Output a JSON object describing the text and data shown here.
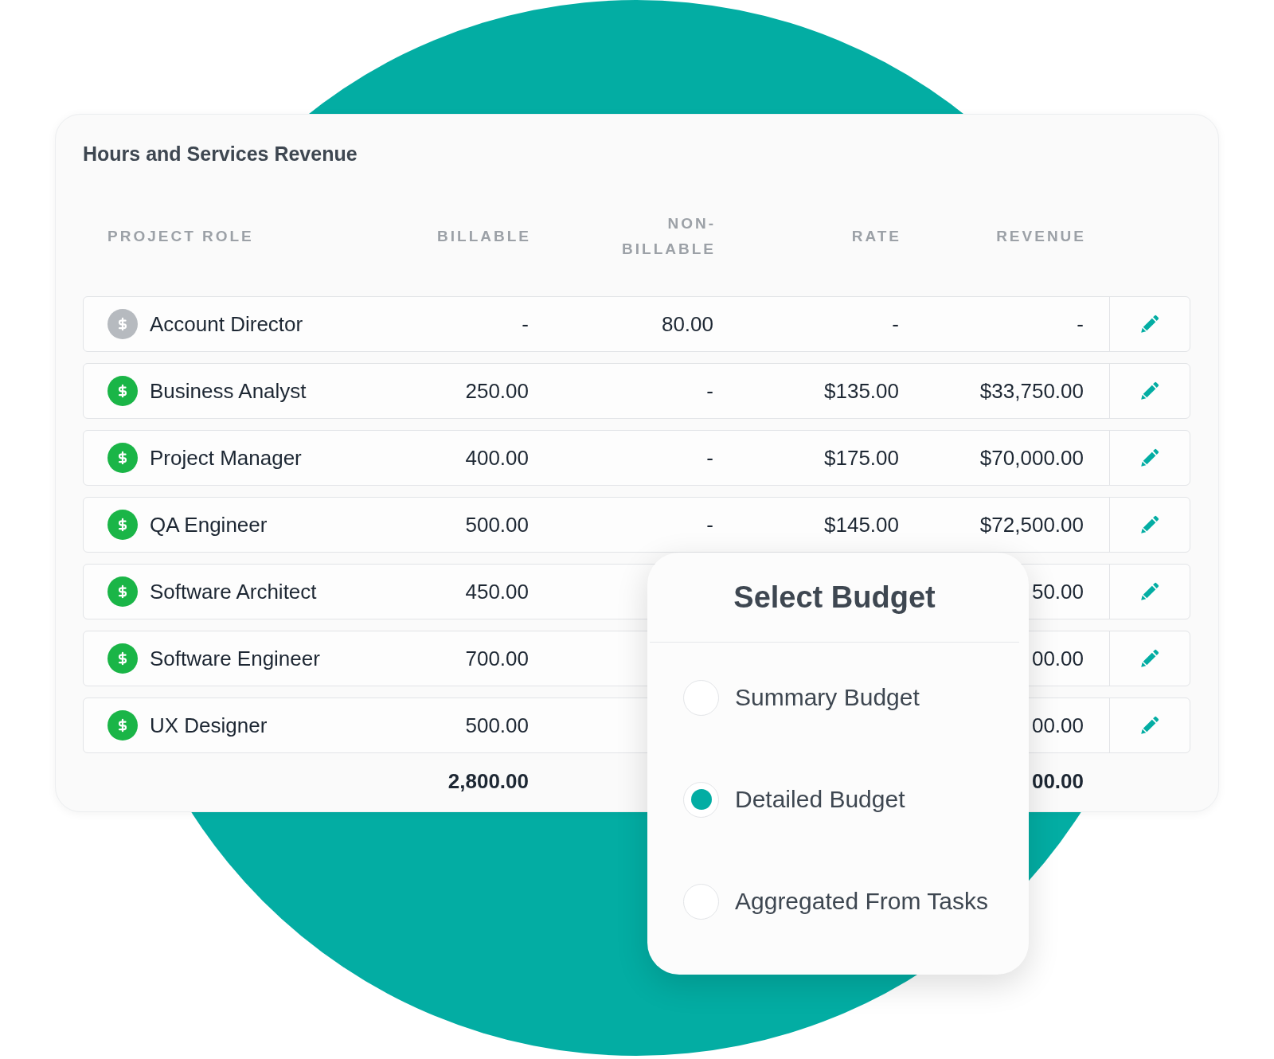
{
  "card": {
    "title": "Hours and Services Revenue"
  },
  "table": {
    "columns": [
      "PROJECT ROLE",
      "BILLABLE",
      "NON-BILLABLE",
      "RATE",
      "REVENUE"
    ],
    "rows": [
      {
        "billable_role": false,
        "role": "Account Director",
        "billable": "-",
        "non_billable": "80.00",
        "rate": "-",
        "revenue": "-"
      },
      {
        "billable_role": true,
        "role": "Business Analyst",
        "billable": "250.00",
        "non_billable": "-",
        "rate": "$135.00",
        "revenue": "$33,750.00"
      },
      {
        "billable_role": true,
        "role": "Project Manager",
        "billable": "400.00",
        "non_billable": "-",
        "rate": "$175.00",
        "revenue": "$70,000.00"
      },
      {
        "billable_role": true,
        "role": "QA Engineer",
        "billable": "500.00",
        "non_billable": "-",
        "rate": "$145.00",
        "revenue": "$72,500.00"
      },
      {
        "billable_role": true,
        "role": "Software Architect",
        "billable": "450.00",
        "revenue": "50.00"
      },
      {
        "billable_role": true,
        "role": "Software Engineer",
        "billable": "700.00",
        "revenue": "00.00"
      },
      {
        "billable_role": true,
        "role": "UX Designer",
        "billable": "500.00",
        "revenue": "00.00"
      }
    ],
    "totals": {
      "billable": "2,800.00",
      "revenue": "00.00"
    }
  },
  "budget_popup": {
    "title": "Select Budget",
    "options": [
      {
        "label": "Summary Budget",
        "selected": false
      },
      {
        "label": "Detailed Budget",
        "selected": true
      },
      {
        "label": "Aggregated From Tasks",
        "selected": false
      }
    ]
  }
}
